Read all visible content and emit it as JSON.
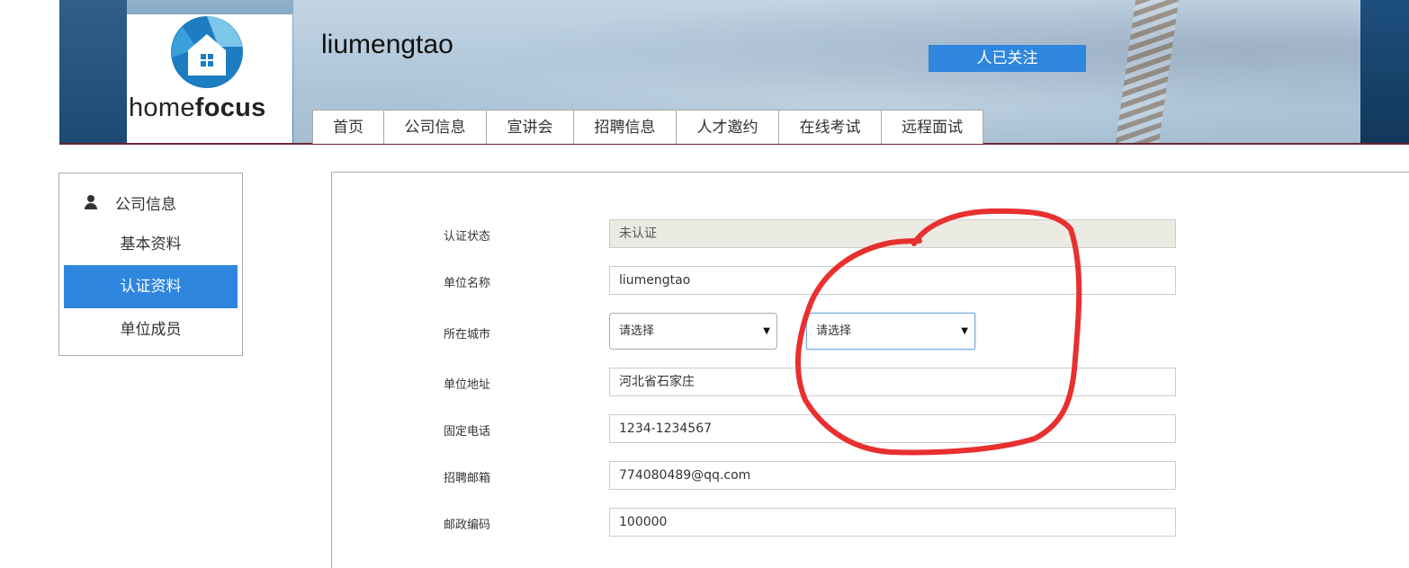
{
  "header": {
    "logo_text_light": "home",
    "logo_text_bold": "focus",
    "company_name": "liumengtao",
    "follow_label": "人已关注"
  },
  "nav": {
    "items": [
      "首页",
      "公司信息",
      "宣讲会",
      "招聘信息",
      "人才邀约",
      "在线考试",
      "远程面试"
    ]
  },
  "sidebar": {
    "heading": "公司信息",
    "items": [
      {
        "label": "基本资料",
        "active": false
      },
      {
        "label": "认证资料",
        "active": true
      },
      {
        "label": "单位成员",
        "active": false
      }
    ]
  },
  "form": {
    "status": {
      "label": "认证状态",
      "value": "未认证"
    },
    "name": {
      "label": "单位名称",
      "value": "liumengtao"
    },
    "city": {
      "label": "所在城市",
      "province_value": "请选择",
      "city_value": "请选择"
    },
    "address": {
      "label": "单位地址",
      "value": "河北省石家庄"
    },
    "phone": {
      "label": "固定电话",
      "value": "1234-1234567"
    },
    "email": {
      "label": "招聘邮箱",
      "value": "774080489@qq.com"
    },
    "postcode": {
      "label": "邮政编码",
      "value": "100000"
    }
  },
  "colors": {
    "accent": "#2e86de",
    "annotation": "#e8302f",
    "banner_border": "#6b2430"
  }
}
